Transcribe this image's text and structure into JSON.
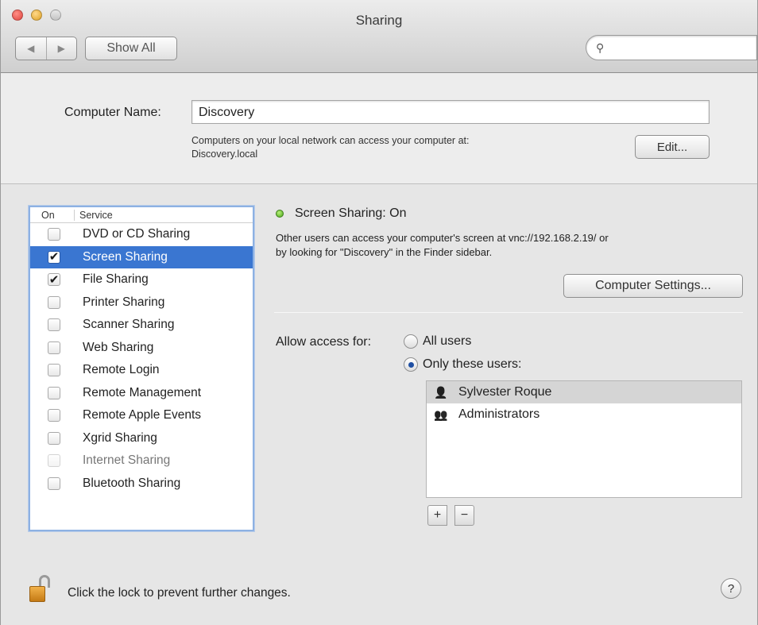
{
  "window": {
    "title": "Sharing"
  },
  "toolbar": {
    "back_icon": "triangle-left",
    "forward_icon": "triangle-right",
    "show_all_label": "Show All",
    "search_placeholder": ""
  },
  "computer": {
    "name_label": "Computer Name:",
    "name_value": "Discovery",
    "note_line1": "Computers on your local network can access your computer at:",
    "note_line2": "Discovery.local",
    "edit_label": "Edit..."
  },
  "services": {
    "header_on": "On",
    "header_service": "Service",
    "items": [
      {
        "label": "DVD or CD Sharing",
        "checked": false,
        "selected": false,
        "enabled": true
      },
      {
        "label": "Screen Sharing",
        "checked": true,
        "selected": true,
        "enabled": true
      },
      {
        "label": "File Sharing",
        "checked": true,
        "selected": false,
        "enabled": true
      },
      {
        "label": "Printer Sharing",
        "checked": false,
        "selected": false,
        "enabled": true
      },
      {
        "label": "Scanner Sharing",
        "checked": false,
        "selected": false,
        "enabled": true
      },
      {
        "label": "Web Sharing",
        "checked": false,
        "selected": false,
        "enabled": true
      },
      {
        "label": "Remote Login",
        "checked": false,
        "selected": false,
        "enabled": true
      },
      {
        "label": "Remote Management",
        "checked": false,
        "selected": false,
        "enabled": true
      },
      {
        "label": "Remote Apple Events",
        "checked": false,
        "selected": false,
        "enabled": true
      },
      {
        "label": "Xgrid Sharing",
        "checked": false,
        "selected": false,
        "enabled": true
      },
      {
        "label": "Internet Sharing",
        "checked": false,
        "selected": false,
        "enabled": false
      },
      {
        "label": "Bluetooth Sharing",
        "checked": false,
        "selected": false,
        "enabled": true
      }
    ]
  },
  "detail": {
    "status": "Screen Sharing: On",
    "status_color": "#4aa61a",
    "desc_line1": "Other users can access your computer's screen at vnc://192.168.2.19/ or",
    "desc_line2": "by looking for \"Discovery\" in the Finder sidebar.",
    "computer_settings_label": "Computer Settings...",
    "allow_label": "Allow access for:",
    "radio_all": "All users",
    "radio_only": "Only these users:",
    "selected_option": "only",
    "users": [
      {
        "name": "Sylvester Roque",
        "icon": "user-icon",
        "selected": true
      },
      {
        "name": "Administrators",
        "icon": "group-icon",
        "selected": false
      }
    ],
    "add_label": "+",
    "remove_label": "−"
  },
  "footer": {
    "lock_text": "Click the lock to prevent further changes.",
    "help_label": "?"
  },
  "colors": {
    "selection": "#3a76d1",
    "accent_border": "#8db1e3"
  }
}
